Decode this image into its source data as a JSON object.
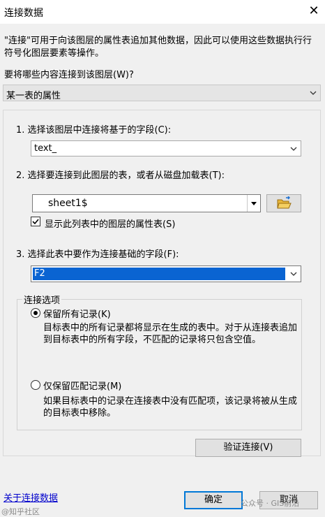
{
  "window": {
    "title": "连接数据",
    "close_glyph": "✕"
  },
  "description": "\"连接\"可用于向该图层的属性表追加其他数据，因此可以使用这些数据执行行符号化图层要素等操作。",
  "join_question": "要将哪些内容连接到该图层(W)?",
  "join_type": {
    "value": "某一表的属性"
  },
  "steps": {
    "step1": {
      "label": "1. 选择该图层中连接将基于的字段(C):",
      "value": "text_"
    },
    "step2": {
      "label": "2. 选择要连接到此图层的表，或者从磁盘加载表(T):",
      "table": "sheet1$",
      "browse_icon": "open-folder-icon",
      "checkbox_label": "显示此列表中的图层的属性表(S)",
      "checkbox_checked": true
    },
    "step3": {
      "label": "3. 选择此表中要作为连接基础的字段(F):",
      "value": "F2"
    }
  },
  "join_options": {
    "title": "连接选项",
    "keep_all": {
      "label": "保留所有记录(K)",
      "description": "目标表中的所有记录都将显示在生成的表中。对于从连接表追加到目标表中的所有字段，不匹配的记录将只包含空值。",
      "selected": true
    },
    "keep_matching": {
      "label": "仅保留匹配记录(M)",
      "description": "如果目标表中的记录在连接表中没有匹配项，该记录将被从生成的目标表中移除。",
      "selected": false
    }
  },
  "buttons": {
    "validate": "验证连接(V)",
    "ok": "确定",
    "cancel": "取消"
  },
  "help_link": "关于连接数据",
  "watermarks": {
    "left": "@知乎社区",
    "right": "公众号 · GIS前沿"
  }
}
